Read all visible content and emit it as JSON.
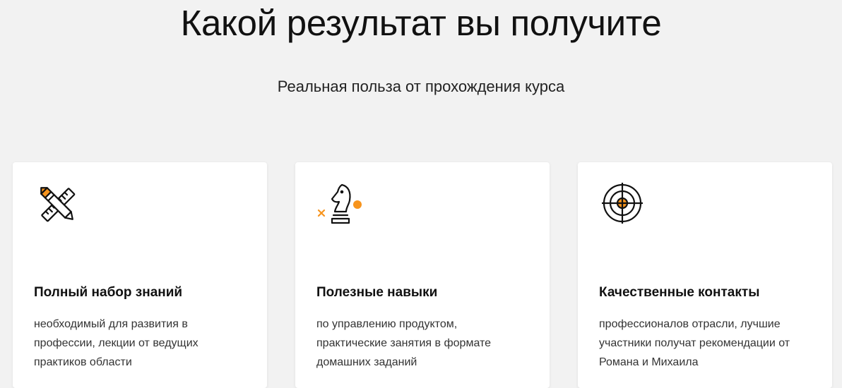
{
  "section": {
    "title": "Какой результат вы получите",
    "subtitle": "Реальная польза от прохождения курса"
  },
  "colors": {
    "accent": "#f7941d",
    "text": "#111111",
    "background": "#f2f2f2",
    "card": "#ffffff"
  },
  "cards": [
    {
      "icon": "pencil-ruler-icon",
      "title": "Полный набор знаний",
      "text": "необходимый для развития в профессии, лекции от ведущих практиков области"
    },
    {
      "icon": "chess-knight-icon",
      "title": "Полезные навыки",
      "text": "по управлению продуктом, практические занятия в формате домашних заданий"
    },
    {
      "icon": "target-icon",
      "title": "Качественные контакты",
      "text": "профессионалов отрасли, лучшие участники получат рекомендации от Романа и Михаила"
    }
  ]
}
